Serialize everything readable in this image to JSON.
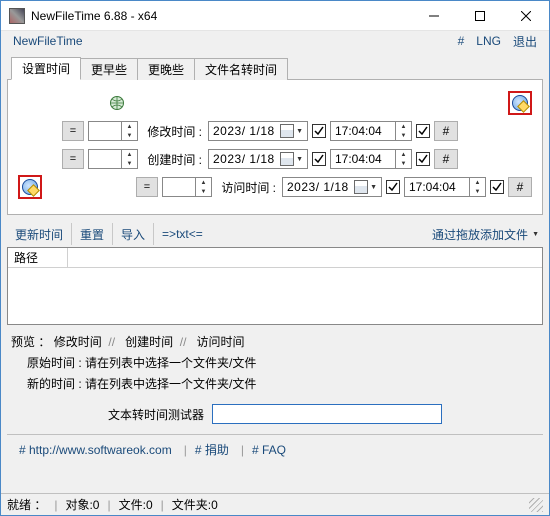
{
  "window": {
    "title": "NewFileTime 6.88 - x64"
  },
  "menubar": {
    "app": "NewFileTime",
    "hash": "#",
    "lng": "LNG",
    "exit": "退出"
  },
  "tabs": {
    "set": "设置时间",
    "earlier": "更早些",
    "later": "更晚些",
    "fromname": "文件名转时间"
  },
  "rows": {
    "eq": "=",
    "modify_label": "修改时间 :",
    "create_label": "创建时间 :",
    "access_label": "访问时间 :",
    "date": "2023/ 1/18",
    "time": "17:04:04",
    "hash": "#"
  },
  "toolbar": {
    "update": "更新时间",
    "reset": "重置",
    "import": "导入",
    "txt": "=>txt<=",
    "dragdrop": "通过拖放添加文件"
  },
  "list": {
    "col_path": "路径"
  },
  "preview": {
    "header_prefix": "预览 ：",
    "modify": "修改时间",
    "create": "创建时间",
    "access": "访问时间",
    "sep": "//",
    "orig_label": "原始时间 :",
    "new_label": "新的时间 :",
    "placeholder": "请在列表中选择一个文件夹/文件"
  },
  "tester": {
    "label": "文本转时间测试器",
    "value": ""
  },
  "footer": {
    "url": "# http://www.softwareok.com",
    "donate": "# 捐助",
    "faq": "# FAQ"
  },
  "status": {
    "ready": "就绪 ：",
    "objects": "对象:0",
    "files": "文件:0",
    "folders": "文件夹:0"
  }
}
